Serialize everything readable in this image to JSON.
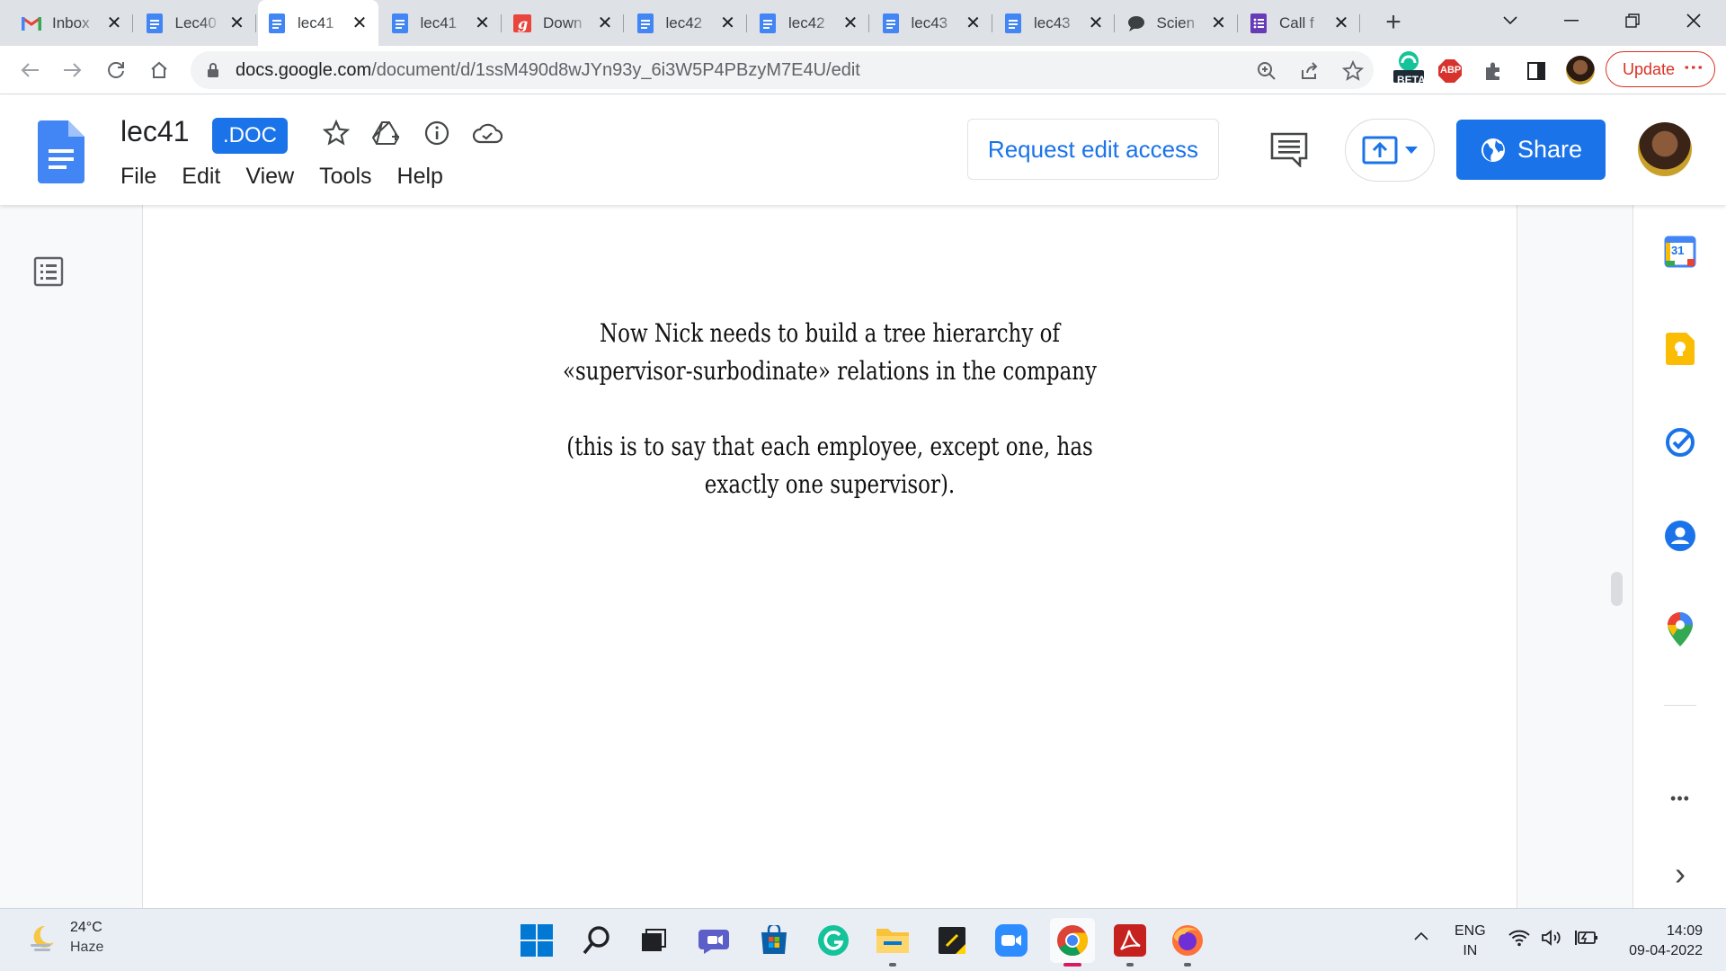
{
  "browser": {
    "tabs": [
      {
        "title": "Inbox",
        "icon": "gmail-icon"
      },
      {
        "title": "Lec40",
        "icon": "docs-icon"
      },
      {
        "title": "lec41",
        "icon": "docs-icon",
        "active": true
      },
      {
        "title": "lec41",
        "icon": "docs-icon"
      },
      {
        "title": "Down",
        "icon": "g-red-icon"
      },
      {
        "title": "lec42",
        "icon": "docs-icon"
      },
      {
        "title": "lec42",
        "icon": "docs-icon"
      },
      {
        "title": "lec43",
        "icon": "docs-icon"
      },
      {
        "title": "lec43",
        "icon": "docs-icon"
      },
      {
        "title": "Scien",
        "icon": "chat-bubble-icon"
      },
      {
        "title": "Call f",
        "icon": "forms-icon"
      }
    ],
    "close_glyph": "✕",
    "new_tab_glyph": "+",
    "url_host": "docs.google.com",
    "url_path": "/document/d/1ssM490d8wJYn93y_6i3W5P4PBzyM7E4U/edit",
    "ext_beta_label": "BETA",
    "ext_abp_label": "ABP",
    "update_label": "Update",
    "update_dots": "⋮"
  },
  "docs": {
    "title": "lec41",
    "badge": ".DOC",
    "menu": [
      "File",
      "Edit",
      "View",
      "Tools",
      "Help"
    ],
    "request_edit_label": "Request edit access",
    "share_label": "Share",
    "accent": "#1a73e8"
  },
  "document": {
    "paragraphs": [
      [
        "Now Nick needs to build a tree hierarchy of",
        "«supervisor-surbodinate» relations in the company"
      ],
      [
        "(this is to say that each employee, except one, has",
        "exactly one supervisor)."
      ]
    ]
  },
  "sidepanel": {
    "calendar_day": "31",
    "more_glyph": "•••",
    "expand_glyph": "›"
  },
  "taskbar": {
    "temp": "24°C",
    "condition": "Haze",
    "lang_top": "ENG",
    "lang_bottom": "IN",
    "time": "14:09",
    "date": "09-04-2022"
  }
}
